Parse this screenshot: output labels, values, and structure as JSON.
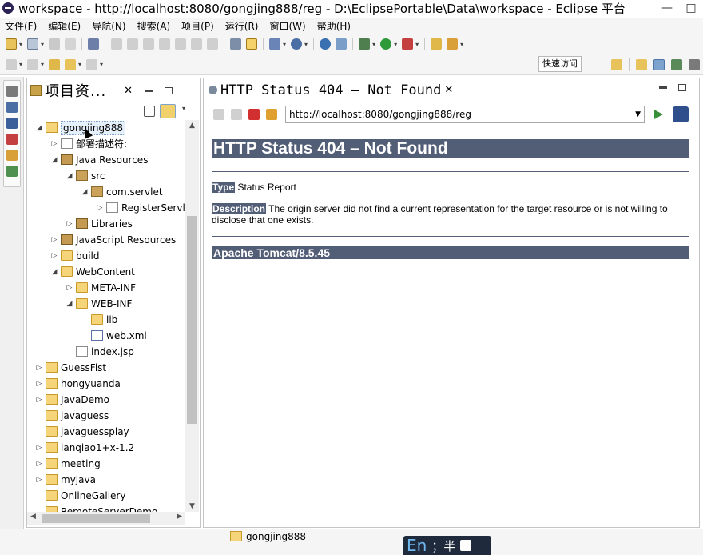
{
  "window": {
    "title": "workspace - http://localhost:8080/gongjing888/reg - D:\\EclipsePortable\\Data\\workspace - Eclipse 平台",
    "min_glyph": "—",
    "max_glyph": "□"
  },
  "menu": [
    "文件(F)",
    "编辑(E)",
    "导航(N)",
    "搜索(A)",
    "项目(P)",
    "运行(R)",
    "窗口(W)",
    "帮助(H)"
  ],
  "toolbar": {
    "quick_access": "快速访问"
  },
  "explorer": {
    "title": "项目资...",
    "close_glyph": "✕",
    "tree": [
      {
        "label": "gongjing888",
        "depth": 0,
        "arrow": "◢",
        "icon": "proj",
        "selected": true
      },
      {
        "label": "部署描述符:",
        "depth": 1,
        "arrow": "▷",
        "icon": "jfile"
      },
      {
        "label": "Java Resources",
        "depth": 1,
        "arrow": "◢",
        "icon": "lib"
      },
      {
        "label": "src",
        "depth": 2,
        "arrow": "◢",
        "icon": "pkg"
      },
      {
        "label": "com.servlet",
        "depth": 3,
        "arrow": "◢",
        "icon": "pkg"
      },
      {
        "label": "RegisterServl",
        "depth": 4,
        "arrow": "▷",
        "icon": "jfile"
      },
      {
        "label": "Libraries",
        "depth": 2,
        "arrow": "▷",
        "icon": "lib"
      },
      {
        "label": "JavaScript Resources",
        "depth": 1,
        "arrow": "▷",
        "icon": "lib"
      },
      {
        "label": "build",
        "depth": 1,
        "arrow": "▷",
        "icon": "folder"
      },
      {
        "label": "WebContent",
        "depth": 1,
        "arrow": "◢",
        "icon": "folder"
      },
      {
        "label": "META-INF",
        "depth": 2,
        "arrow": "▷",
        "icon": "folder"
      },
      {
        "label": "WEB-INF",
        "depth": 2,
        "arrow": "◢",
        "icon": "folder"
      },
      {
        "label": "lib",
        "depth": 3,
        "arrow": "",
        "icon": "folder"
      },
      {
        "label": "web.xml",
        "depth": 3,
        "arrow": "",
        "icon": "xfile"
      },
      {
        "label": "index.jsp",
        "depth": 2,
        "arrow": "",
        "icon": "jfile"
      },
      {
        "label": "GuessFist",
        "depth": 0,
        "arrow": "▷",
        "icon": "proj"
      },
      {
        "label": "hongyuanda",
        "depth": 0,
        "arrow": "▷",
        "icon": "proj"
      },
      {
        "label": "JavaDemo",
        "depth": 0,
        "arrow": "▷",
        "icon": "proj"
      },
      {
        "label": "javaguess",
        "depth": 0,
        "arrow": "",
        "icon": "folder"
      },
      {
        "label": "javaguessplay",
        "depth": 0,
        "arrow": "",
        "icon": "folder"
      },
      {
        "label": "lanqiao1+x-1.2",
        "depth": 0,
        "arrow": "▷",
        "icon": "proj"
      },
      {
        "label": "meeting",
        "depth": 0,
        "arrow": "▷",
        "icon": "proj"
      },
      {
        "label": "myjava",
        "depth": 0,
        "arrow": "▷",
        "icon": "proj"
      },
      {
        "label": "OnlineGallery",
        "depth": 0,
        "arrow": "",
        "icon": "folder"
      },
      {
        "label": "RemoteServerDemo",
        "depth": 0,
        "arrow": "",
        "icon": "folder"
      }
    ]
  },
  "browser": {
    "tab_title": "HTTP Status 404 – Not Found",
    "close_glyph": "✕",
    "url": "http://localhost:8080/gongjing888/reg",
    "heading": "HTTP Status 404 – Not Found",
    "type_label": "Type",
    "type_value": " Status Report",
    "desc_label": "Description",
    "desc_value": " The origin server did not find a current representation for the target resource or is not willing to disclose that one exists.",
    "footer": "Apache Tomcat/8.5.45"
  },
  "status": {
    "project": "gongjing888"
  },
  "ime": {
    "lang": "En",
    "rest": "；半"
  },
  "glyphs": {
    "dropdown": "▾",
    "url_dropdown": "▼",
    "scroll_up": "▲",
    "scroll_down": "▼",
    "scroll_left": "◀",
    "scroll_right": "▶"
  }
}
